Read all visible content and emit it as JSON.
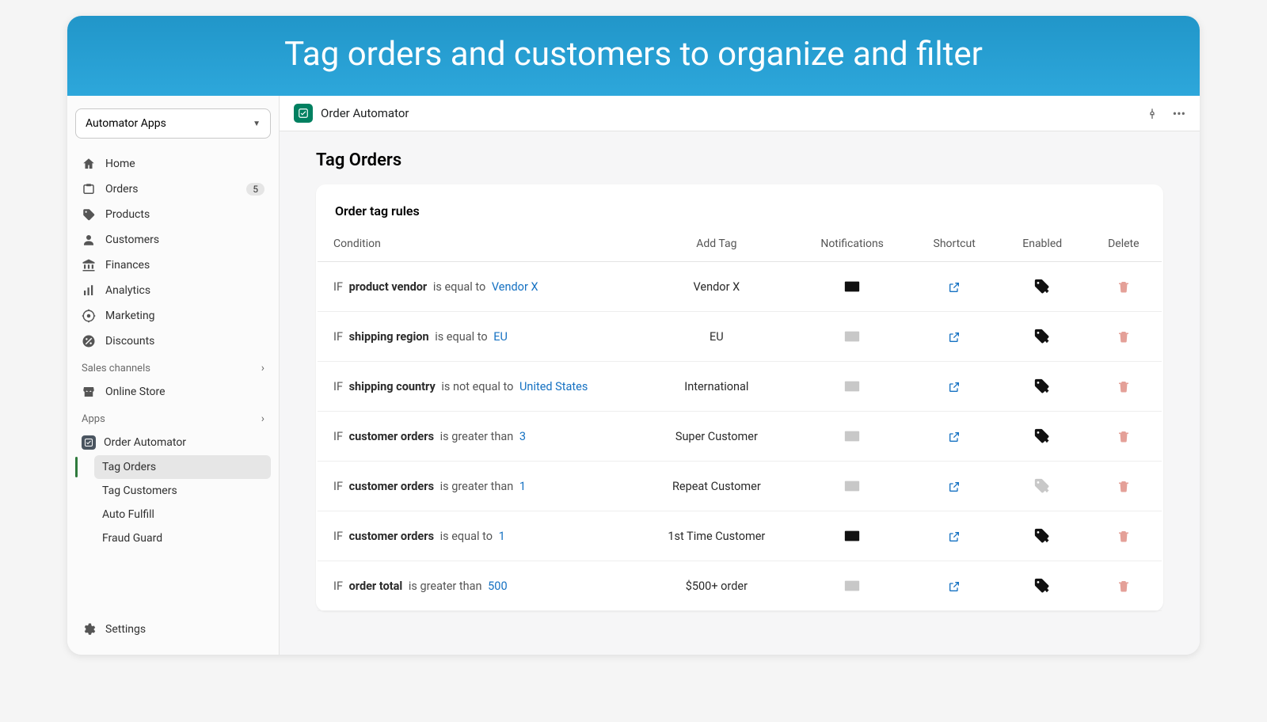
{
  "hero": {
    "title": "Tag orders and customers to organize and filter"
  },
  "sidebar": {
    "selector_label": "Automator Apps",
    "nav": [
      {
        "label": "Home",
        "icon": "home"
      },
      {
        "label": "Orders",
        "icon": "orders",
        "badge": "5"
      },
      {
        "label": "Products",
        "icon": "tag"
      },
      {
        "label": "Customers",
        "icon": "person"
      },
      {
        "label": "Finances",
        "icon": "bank"
      },
      {
        "label": "Analytics",
        "icon": "bars"
      },
      {
        "label": "Marketing",
        "icon": "target"
      },
      {
        "label": "Discounts",
        "icon": "percent"
      }
    ],
    "sections": {
      "sales": "Sales channels",
      "apps": "Apps"
    },
    "sales_items": [
      {
        "label": "Online Store",
        "icon": "store"
      }
    ],
    "apps_items": [
      {
        "label": "Order Automator",
        "sub": [
          {
            "label": "Tag Orders",
            "active": true
          },
          {
            "label": "Tag Customers"
          },
          {
            "label": "Auto Fulfill"
          },
          {
            "label": "Fraud Guard"
          }
        ]
      }
    ],
    "settings_label": "Settings"
  },
  "topbar": {
    "title": "Order Automator"
  },
  "page": {
    "title": "Tag Orders",
    "card_title": "Order tag rules",
    "columns": {
      "condition": "Condition",
      "add_tag": "Add Tag",
      "notifications": "Notifications",
      "shortcut": "Shortcut",
      "enabled": "Enabled",
      "delete": "Delete"
    },
    "rules": [
      {
        "if": "IF",
        "field": "product vendor",
        "op": "is equal to",
        "value": "Vendor X",
        "tag": "Vendor X",
        "notif": true,
        "enabled": true
      },
      {
        "if": "IF",
        "field": "shipping region",
        "op": "is equal to",
        "value": "EU",
        "tag": "EU",
        "notif": false,
        "enabled": true
      },
      {
        "if": "IF",
        "field": "shipping country",
        "op": "is not equal to",
        "value": "United States",
        "tag": "International",
        "notif": false,
        "enabled": true
      },
      {
        "if": "IF",
        "field": "customer orders",
        "op": "is greater than",
        "value": "3",
        "tag": "Super Customer",
        "notif": false,
        "enabled": true
      },
      {
        "if": "IF",
        "field": "customer orders",
        "op": "is greater than",
        "value": "1",
        "tag": "Repeat Customer",
        "notif": false,
        "enabled": false
      },
      {
        "if": "IF",
        "field": "customer orders",
        "op": "is equal to",
        "value": "1",
        "tag": "1st Time Customer",
        "notif": true,
        "enabled": true
      },
      {
        "if": "IF",
        "field": "order total",
        "op": "is greater than",
        "value": "500",
        "tag": "$500+ order",
        "notif": false,
        "enabled": true
      }
    ]
  }
}
